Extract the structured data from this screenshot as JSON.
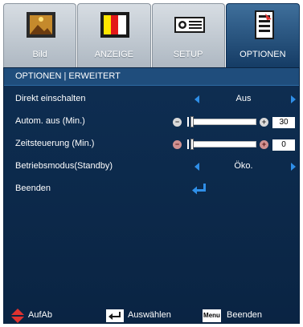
{
  "tabs": [
    {
      "label": "Bild",
      "icon": "picture-icon",
      "active": false
    },
    {
      "label": "ANZEIGE",
      "icon": "color-bars-icon",
      "active": false
    },
    {
      "label": "SETUP",
      "icon": "projector-icon",
      "active": false
    },
    {
      "label": "OPTIONEN",
      "icon": "settings-list-icon",
      "active": true
    }
  ],
  "breadcrumb": "OPTIONEN | ERWEITERT",
  "rows": {
    "direct_power": {
      "label": "Direkt einschalten",
      "value": "Aus"
    },
    "auto_off": {
      "label": "Autom. aus (Min.)",
      "value": "30",
      "level": 0.0
    },
    "timer": {
      "label": "Zeitsteuerung (Min.)",
      "value": "0",
      "level": 0.0
    },
    "standby_mode": {
      "label": "Betriebsmodus(Standby)",
      "value": "Öko."
    },
    "exit": {
      "label": "Beenden"
    }
  },
  "footer": {
    "navigate": "AufAb",
    "select": "Auswählen",
    "menu_key": "Menu",
    "exit": "Beenden"
  },
  "colors": {
    "accent": "#2f8fe8",
    "panel": "#0e2e52",
    "active_tab": "#153c65",
    "red_arrow": "#e0322f"
  }
}
